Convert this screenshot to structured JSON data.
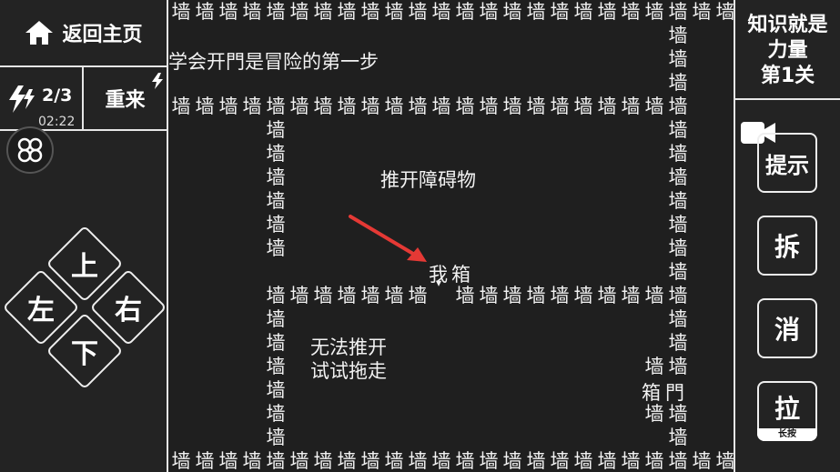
{
  "left_panel": {
    "home_label": "返回主页",
    "energy": "2/3",
    "timer": "02:22",
    "restart_label": "重来",
    "dpad": {
      "up": "上",
      "left": "左",
      "right": "右",
      "down": "下"
    }
  },
  "right_panel": {
    "level_line1": "知识就是",
    "level_line2": "力量",
    "level_line3": "第1关",
    "hint_label": "提示",
    "dismantle_label": "拆",
    "eliminate_label": "消",
    "pull_label": "拉",
    "long_press_label": "长按"
  },
  "board": {
    "wall_char": "墙",
    "texts": {
      "title": "学会开門是冒险的第一步",
      "push_hint": "推开障碍物",
      "cannot_push_1": "无法推开",
      "cannot_push_2": "试试拖走",
      "player": "我",
      "box_main": "箱",
      "box_corner": "箱",
      "door_corner": "門"
    }
  },
  "colors": {
    "arrow": "#e53935",
    "background": "#1f1f1f",
    "border": "#e6e6e6"
  }
}
